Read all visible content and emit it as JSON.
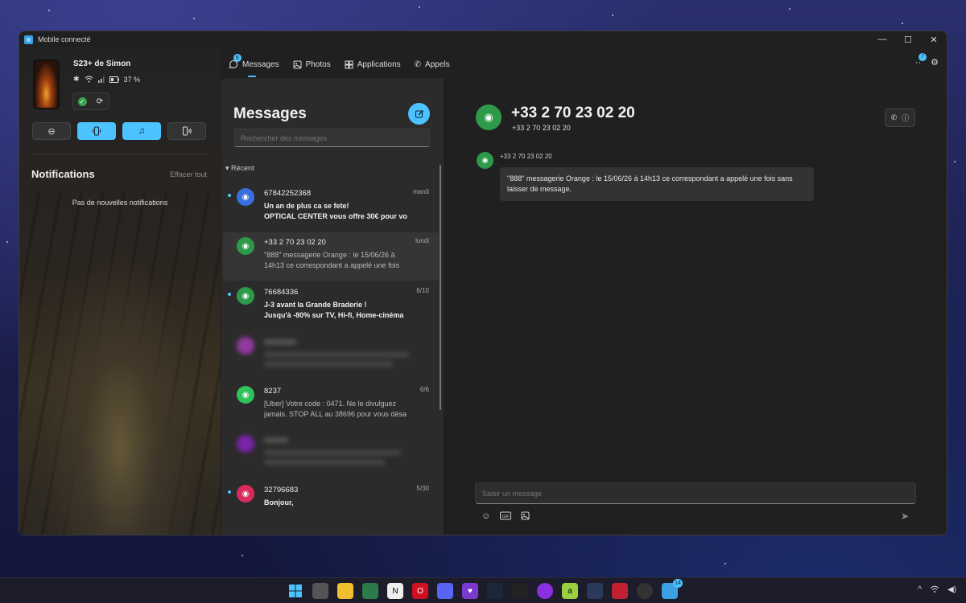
{
  "window": {
    "title": "Mobile connecté",
    "minimize": "—",
    "maximize": "☐",
    "close": "✕"
  },
  "device": {
    "name": "S23+ de Simon",
    "battery": "37 %"
  },
  "notifications": {
    "title": "Notifications",
    "clear": "Effacer tout",
    "empty": "Pas de nouvelles notifications"
  },
  "tabs": [
    {
      "label": "Messages",
      "badge": "6"
    },
    {
      "label": "Photos"
    },
    {
      "label": "Applications"
    },
    {
      "label": "Appels"
    }
  ],
  "header_right": {
    "badge": "7"
  },
  "messages": {
    "title": "Messages",
    "search_placeholder": "Rechercher des messages",
    "section": "Récent",
    "items": [
      {
        "name": "67842252368",
        "date": "mardi",
        "body": "Un an de plus ca se fete!\nOPTICAL CENTER vous offre 30€ pour vo",
        "color": "#3a6fe0",
        "unread": true
      },
      {
        "name": "+33 2 70 23 02 20",
        "date": "lundi",
        "body": "\"888\" messagerie Orange : le 15/06/26 à\n14h13 ce correspondant a appelé une fois",
        "color": "#2d9a4a",
        "unread": false
      },
      {
        "name": "76684336",
        "date": "6/10",
        "body": "J-3 avant la Grande Braderie !\nJusqu'à -80% sur TV, Hi-fi, Home-cinéma",
        "color": "#2d9a4a",
        "unread": true
      },
      {
        "name": "8237",
        "date": "6/6",
        "body": "[Uber] Votre code : 0471. Ne le divulguez\njamais. STOP ALL au 38696 pour vous désa",
        "color": "#2fc25a",
        "unread": false
      },
      {
        "name": "32796683",
        "date": "5/30",
        "body": "Bonjour,",
        "color": "#d92b5c",
        "unread": true
      }
    ]
  },
  "conversation": {
    "name": "+33 2 70 23 02 20",
    "subtitle": "+33 2 70 23 02 20",
    "sender": "+33 2 70 23 02 20",
    "bubble": "\"888\" messagerie Orange : le 15/06/26 à 14h13 ce correspondant a appelé une fois sans laisser de message.",
    "input_placeholder": "Saisir un message"
  },
  "taskbar": {
    "badge": "14"
  }
}
